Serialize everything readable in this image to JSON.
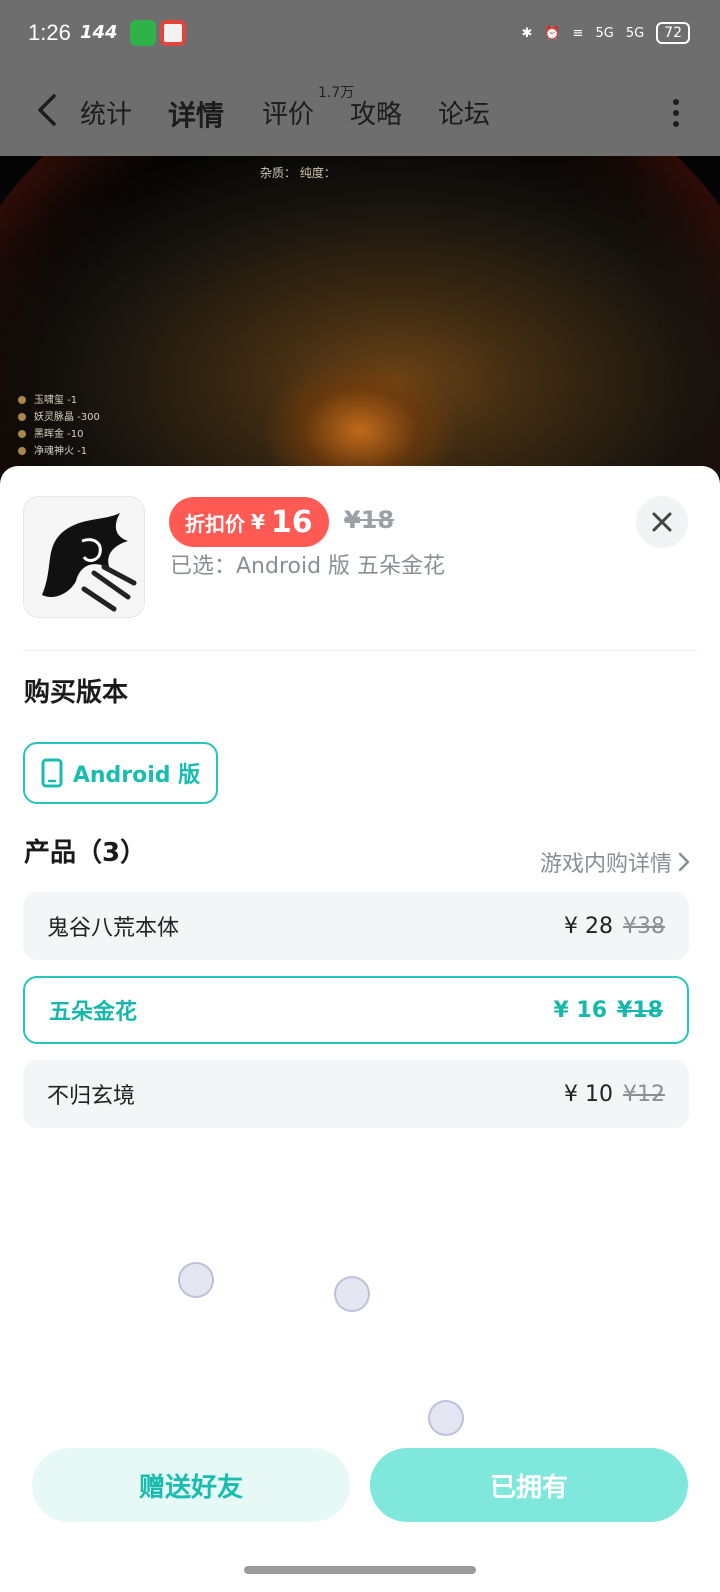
{
  "status_bar": {
    "time": "1:26",
    "refresh_rate": "144",
    "battery": "72",
    "network_1": "5G",
    "network_2": "5G"
  },
  "nav": {
    "tabs": [
      {
        "label": "统计"
      },
      {
        "label": "详情"
      },
      {
        "label": "评价"
      },
      {
        "label": "攻略"
      },
      {
        "label": "论坛"
      }
    ],
    "active_tab": "详情",
    "review_count_badge": "1.7万"
  },
  "game_preview": {
    "top_stats": "杂质：    纯度：",
    "legend": [
      "玉啸玺 -1",
      "妖灵脉晶 -300",
      "黑晖金 -10",
      "净魂神火 -1"
    ]
  },
  "purchase_sheet": {
    "discount_label": "折扣价",
    "currency": "¥",
    "discount_price": "16",
    "original_price": "¥18",
    "selected_text": "已选：Android 版 五朵金花",
    "version_title": "购买版本",
    "version_option": "Android 版",
    "products_title": "产品（3）",
    "detail_link": "游戏内购详情",
    "products": [
      {
        "name": "鬼谷八荒本体",
        "price": "¥ 28",
        "old_price": "¥38",
        "selected": false
      },
      {
        "name": "五朵金花",
        "price": "¥ 16",
        "old_price": "¥18",
        "selected": true
      },
      {
        "name": "不归玄境",
        "price": "¥ 10",
        "old_price": "¥12",
        "selected": false
      }
    ],
    "gift_button": "赠送好友",
    "owned_button": "已拥有"
  },
  "colors": {
    "accent": "#22c7b8",
    "discount_red": "#ff5a54",
    "overlay_gray": "#6e6e6e"
  }
}
